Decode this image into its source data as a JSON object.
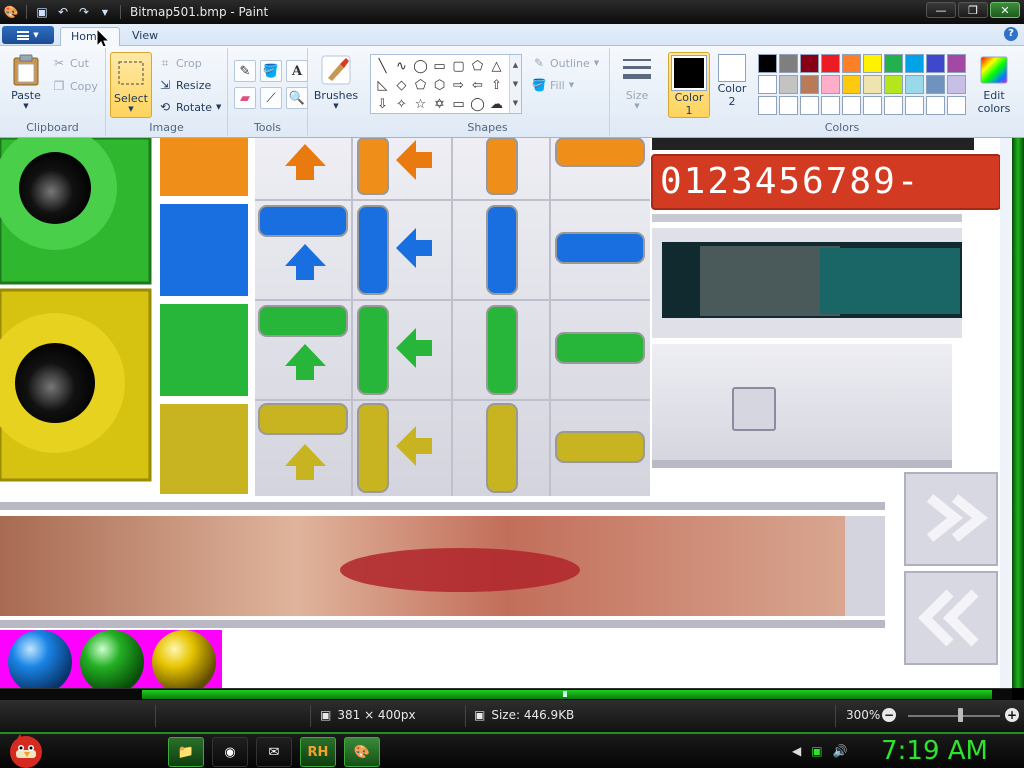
{
  "window": {
    "title": "Bitmap501.bmp - Paint",
    "controls": [
      "—",
      "❐",
      "✕"
    ]
  },
  "quick_access": {
    "paint_icon": "paint-icon",
    "save": "save-icon",
    "undo": "undo-icon",
    "redo": "redo-icon",
    "dropdown": "chevron-down-icon"
  },
  "tabs": [
    {
      "label": "Home"
    },
    {
      "label": "View"
    }
  ],
  "ribbon": {
    "clipboard": {
      "label": "Clipboard",
      "paste": "Paste",
      "cut": "Cut",
      "copy": "Copy"
    },
    "image": {
      "label": "Image",
      "select": "Select",
      "crop": "Crop",
      "resize": "Resize",
      "rotate": "Rotate"
    },
    "tools": {
      "label": "Tools"
    },
    "brushes": {
      "label": "Brushes"
    },
    "shapes": {
      "label": "Shapes",
      "outline": "Outline",
      "fill": "Fill"
    },
    "size": {
      "label": "Size"
    },
    "colors": {
      "label": "Colors",
      "color1": "Color",
      "color1_num": "1",
      "color2": "Color",
      "color2_num": "2",
      "edit": "Edit",
      "edit2": "colors",
      "color1_value": "#000000",
      "color2_value": "#ffffff",
      "palette": [
        "#000000",
        "#7f7f7f",
        "#880015",
        "#ed1c24",
        "#ff7f27",
        "#fff200",
        "#22b14c",
        "#00a2e8",
        "#3f48cc",
        "#a349a4",
        "#ffffff",
        "#c3c3c3",
        "#b97a57",
        "#ffaec9",
        "#ffc90e",
        "#efe4b0",
        "#b5e61d",
        "#99d9ea",
        "#7092be",
        "#c8bfe7",
        "#ffffff",
        "#ffffff",
        "#ffffff",
        "#ffffff",
        "#ffffff",
        "#ffffff",
        "#ffffff",
        "#ffffff",
        "#ffffff",
        "#ffffff"
      ]
    }
  },
  "canvas": {
    "digits": "0123456789-"
  },
  "status": {
    "dimensions": "381 × 400px",
    "size": "Size: 446.9KB",
    "zoom": "300%"
  },
  "taskbar": {
    "clock": "7:19 AM",
    "app_label": "RH"
  }
}
